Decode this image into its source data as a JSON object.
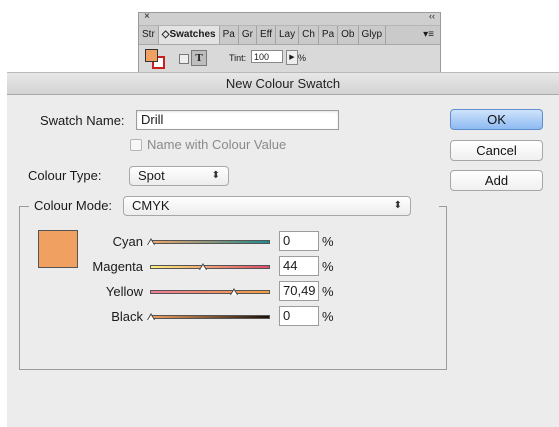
{
  "panel": {
    "close_glyph": "×",
    "collapse_glyph": "‹‹",
    "tabs": [
      "Str",
      "◇Swatches",
      "Pa",
      "Gr",
      "Eff",
      "Lay",
      "Ch",
      "Pa",
      "Ob",
      "Glyp"
    ],
    "menu_glyph": "▾≡",
    "text_btn": "T",
    "tint_label": "Tint:",
    "tint_value": "100",
    "tint_arrow": "▶",
    "tint_unit": "%",
    "fill_color": "#f0a060",
    "stroke_color": "#c82020"
  },
  "dialog": {
    "title": "New Colour Swatch",
    "swatch_name_label": "Swatch Name:",
    "swatch_name_value": "Drill",
    "name_with_value_label": "Name with Colour Value",
    "colour_type_label": "Colour Type:",
    "colour_type_value": "Spot",
    "colour_mode_label": "Colour Mode:",
    "colour_mode_value": "CMYK",
    "select_arrow": "⬍",
    "buttons": {
      "ok": "OK",
      "cancel": "Cancel",
      "add": "Add"
    },
    "preview_color": "#f0a060",
    "percent_sign": "%",
    "inks": [
      {
        "name": "Cyan",
        "value": "0",
        "level": 0,
        "gradient": "linear-gradient(90deg,#f4a468,#1f8a8f)"
      },
      {
        "name": "Magenta",
        "value": "44",
        "level": 44,
        "gradient": "linear-gradient(90deg,#fbf07a,#e04a6a)"
      },
      {
        "name": "Yellow",
        "value": "70,49",
        "level": 70.49,
        "gradient": "linear-gradient(90deg,#f07a9a,#f0a040)"
      },
      {
        "name": "Black",
        "value": "0",
        "level": 0,
        "gradient": "linear-gradient(90deg,#f0a060,#1a1008)"
      }
    ]
  }
}
